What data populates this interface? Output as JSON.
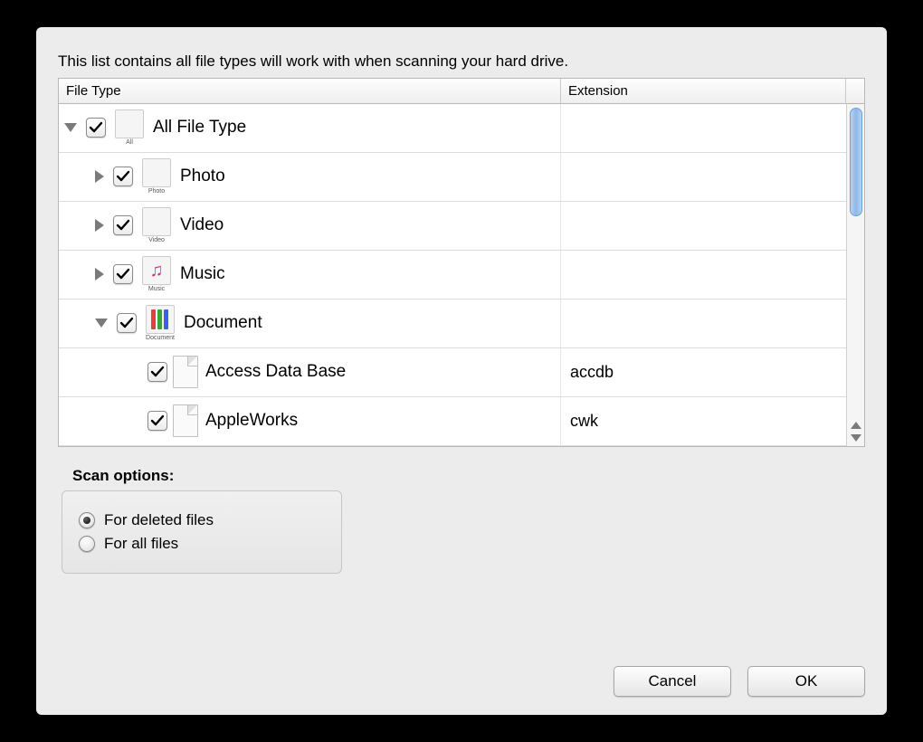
{
  "description": "This list contains all file types will work with when scanning your hard drive.",
  "columns": {
    "type": "File Type",
    "extension": "Extension"
  },
  "tree": [
    {
      "label": "All File Type",
      "ext": "",
      "indent": 0,
      "disclosure": "down",
      "checked": true,
      "icon": "all",
      "caption": "All"
    },
    {
      "label": "Photo",
      "ext": "",
      "indent": 1,
      "disclosure": "right",
      "checked": true,
      "icon": "photo",
      "caption": "Photo"
    },
    {
      "label": "Video",
      "ext": "",
      "indent": 1,
      "disclosure": "right",
      "checked": true,
      "icon": "video",
      "caption": "Video"
    },
    {
      "label": "Music",
      "ext": "",
      "indent": 1,
      "disclosure": "right",
      "checked": true,
      "icon": "music",
      "caption": "Music"
    },
    {
      "label": "Document",
      "ext": "",
      "indent": 1,
      "disclosure": "down",
      "checked": true,
      "icon": "doc",
      "caption": "Document"
    },
    {
      "label": "Access Data Base",
      "ext": "accdb",
      "indent": 2,
      "disclosure": "none",
      "checked": true,
      "icon": "file",
      "caption": ""
    },
    {
      "label": "AppleWorks",
      "ext": "cwk",
      "indent": 2,
      "disclosure": "none",
      "checked": true,
      "icon": "file",
      "caption": ""
    }
  ],
  "scan": {
    "label": "Scan options:",
    "options": [
      "For deleted files",
      "For all files"
    ],
    "selected": 0
  },
  "buttons": {
    "cancel": "Cancel",
    "ok": "OK"
  }
}
